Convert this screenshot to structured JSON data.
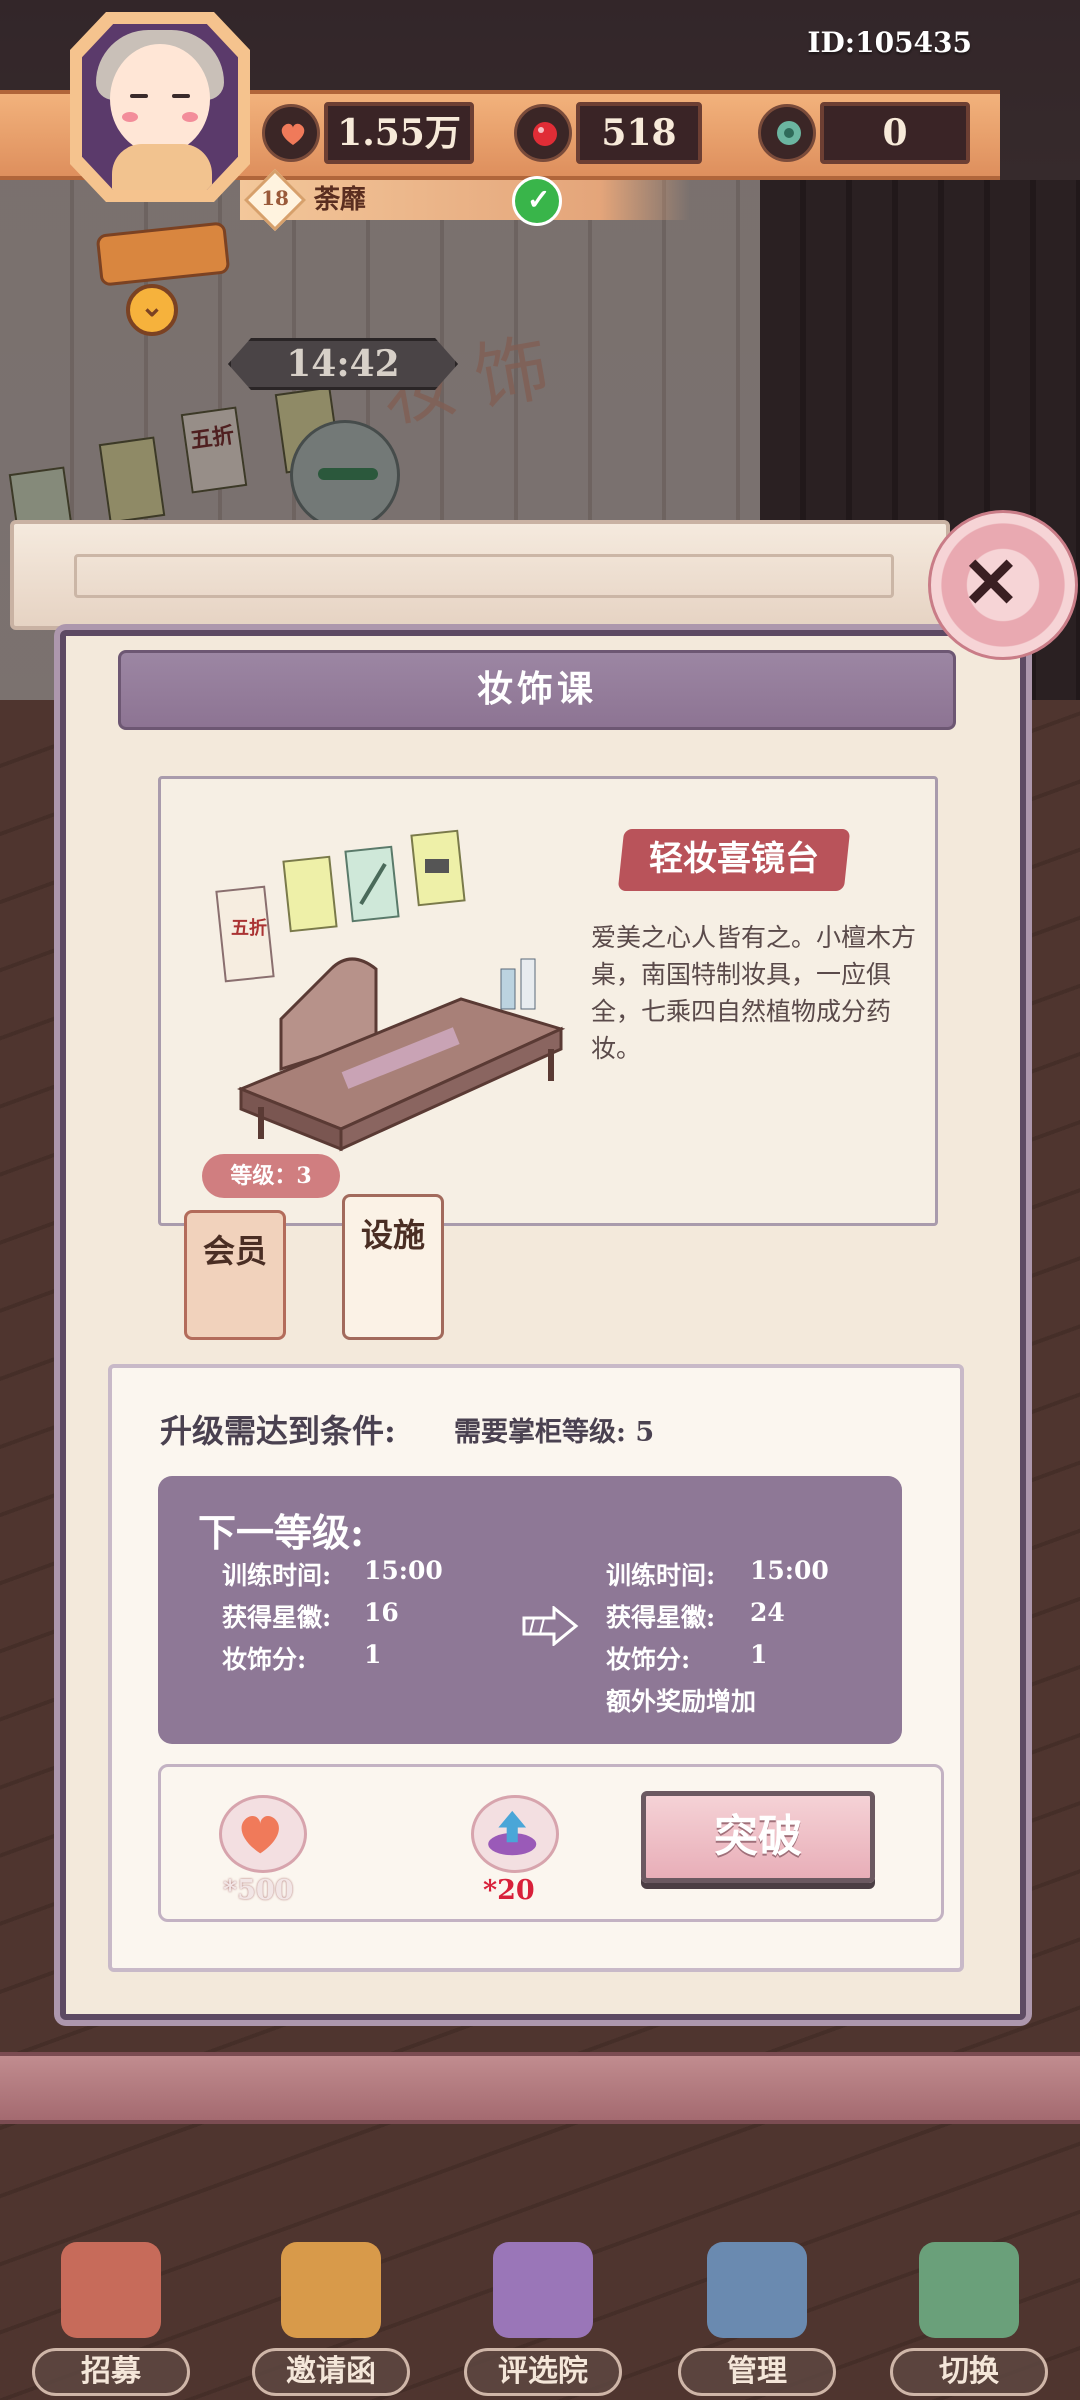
{
  "player": {
    "id": "ID:105435",
    "rank": "18",
    "name": "荼靡"
  },
  "resources": [
    {
      "icon": "heart-currency-icon",
      "value": "1.55万"
    },
    {
      "icon": "red-gem-icon",
      "value": "518"
    },
    {
      "icon": "green-coin-icon",
      "value": "0"
    }
  ],
  "timer": "14:42",
  "shop_sign": "妆饰",
  "poster_text": "五折",
  "panel": {
    "title": "妆饰课",
    "furniture": {
      "name": "轻妆喜镜台",
      "description": "爱美之心人皆有之。小檀木方桌，南国特制妆具，一应俱全，七乘四自然植物成分药妆。",
      "level": "等级：3",
      "image_poster_text": "五折"
    },
    "tabs": [
      {
        "label": "会员"
      },
      {
        "label": "设施"
      }
    ],
    "requirement": {
      "label": "升级需达到条件:",
      "value": "需要掌柜等级: 5"
    },
    "next_level": {
      "title": "下一等级:",
      "current": [
        {
          "label": "训练时间:",
          "value": "15:00"
        },
        {
          "label": "获得星徽:",
          "value": "16"
        },
        {
          "label": "妆饰分:",
          "value": "1"
        }
      ],
      "upgraded": [
        {
          "label": "训练时间:",
          "value": "15:00"
        },
        {
          "label": "获得星徽:",
          "value": "24"
        },
        {
          "label": "妆饰分:",
          "value": "1"
        }
      ],
      "extra": "额外奖励增加"
    },
    "costs": [
      {
        "icon": "heart-currency-icon",
        "amount": "*500",
        "color": "#f2e6e6"
      },
      {
        "icon": "upgrade-arrow-icon",
        "amount": "*20",
        "color": "#d8203a"
      }
    ],
    "action_button": "突破",
    "close_icon": "close-icon"
  },
  "bottom_nav": [
    {
      "label": "招募",
      "icon": "recruit-icon",
      "color": "#c76b5a"
    },
    {
      "label": "邀请函",
      "icon": "invitation-icon",
      "color": "#d89a4a"
    },
    {
      "label": "评选院",
      "icon": "selection-hall-icon",
      "color": "#9a76b8"
    },
    {
      "label": "管理",
      "icon": "manage-icon",
      "color": "#6a8ab0"
    },
    {
      "label": "切换",
      "icon": "switch-map-icon",
      "color": "#6aa07a"
    }
  ],
  "colors": {
    "panel_border": "#5d4a63",
    "title_bar": "#9c86a3",
    "next_box": "#8e7896",
    "name_tag": "#b9535a"
  }
}
